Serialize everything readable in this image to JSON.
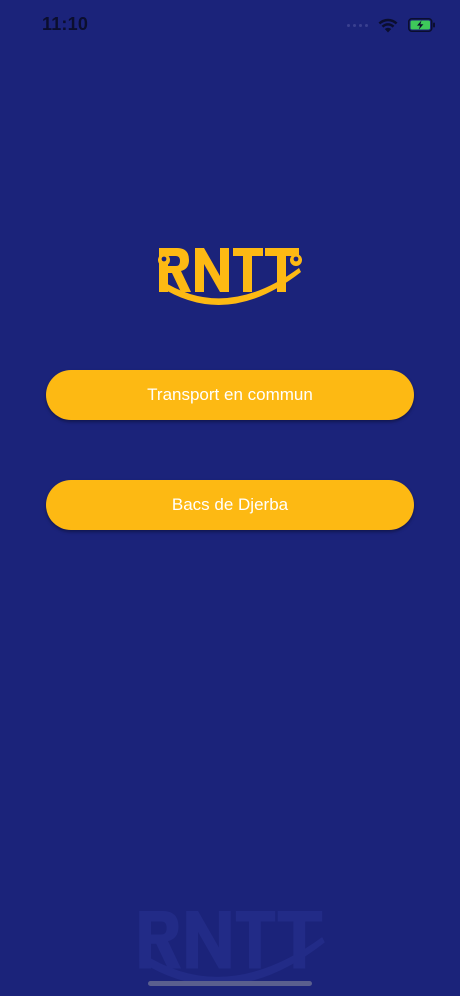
{
  "status_bar": {
    "time": "11:10",
    "icons": [
      "dots-icon",
      "wifi-icon",
      "battery-charging-icon"
    ]
  },
  "logo": {
    "text": "RNTT",
    "icon": "rntt-logo",
    "color": "#fdb913"
  },
  "buttons": {
    "transport_label": "Transport en commun",
    "bacs_label": "Bacs de Djerba"
  },
  "colors": {
    "background": "#1b237a",
    "accent": "#fdb913",
    "button_text": "#ffffff"
  }
}
